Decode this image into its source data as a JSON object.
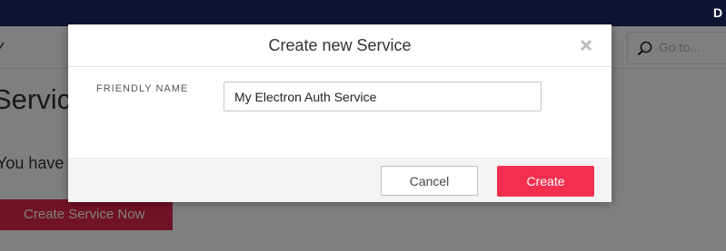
{
  "app": {
    "user_initial": "D",
    "search": {
      "placeholder": "Go to...",
      "value": ""
    },
    "page_heading": "Service",
    "page_text": "You have",
    "create_now_label": "Create Service Now"
  },
  "modal": {
    "title": "Create new Service",
    "close_icon": "close-icon",
    "field_label": "FRIENDLY NAME",
    "field_value": "My Electron Auth Service",
    "cancel_label": "Cancel",
    "create_label": "Create"
  },
  "colors": {
    "topbar": "#0f1533",
    "accent": "#f22f4f",
    "backdrop": "rgba(0,0,0,0.5)"
  }
}
